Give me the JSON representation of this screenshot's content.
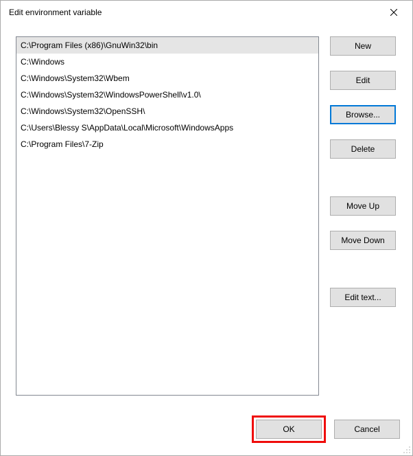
{
  "title": "Edit environment variable",
  "paths": [
    "C:\\Program Files (x86)\\GnuWin32\\bin",
    "C:\\Windows",
    "C:\\Windows\\System32\\Wbem",
    "C:\\Windows\\System32\\WindowsPowerShell\\v1.0\\",
    "C:\\Windows\\System32\\OpenSSH\\",
    "C:\\Users\\Blessy S\\AppData\\Local\\Microsoft\\WindowsApps",
    "C:\\Program Files\\7-Zip"
  ],
  "selected_index": 0,
  "buttons": {
    "new": "New",
    "edit": "Edit",
    "browse": "Browse...",
    "delete": "Delete",
    "move_up": "Move Up",
    "move_down": "Move Down",
    "edit_text": "Edit text...",
    "ok": "OK",
    "cancel": "Cancel"
  }
}
